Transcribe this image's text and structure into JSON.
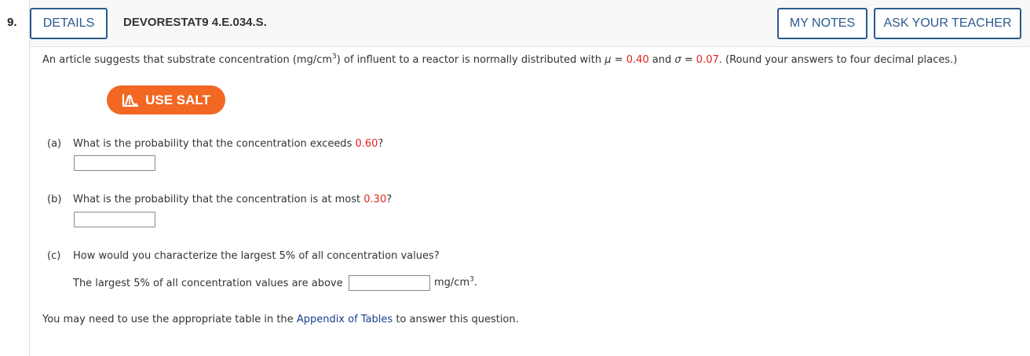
{
  "question_number": "9.",
  "header": {
    "details_label": "DETAILS",
    "question_id": "DEVORESTAT9 4.E.034.S.",
    "my_notes_label": "MY NOTES",
    "ask_teacher_label": "ASK YOUR TEACHER"
  },
  "intro": {
    "text1": "An article suggests that substrate concentration (mg/cm",
    "sup": "3",
    "text2": ") of influent to a reactor is normally distributed with ",
    "mu_symbol": "μ",
    "eq1": " = ",
    "mu_value": "0.40",
    "and": " and ",
    "sigma_symbol": "σ",
    "eq2": " = ",
    "sigma_value": "0.07",
    "text3": ". (Round your answers to four decimal places.)"
  },
  "salt_button": {
    "label": "USE SALT",
    "color": "#f26722"
  },
  "parts": {
    "a": {
      "label": "(a)",
      "question": "What is the probability that the concentration exceeds ",
      "value": "0.60",
      "end": "?",
      "answer": ""
    },
    "b": {
      "label": "(b)",
      "question": "What is the probability that the concentration is at most ",
      "value": "0.30",
      "end": "?",
      "answer": ""
    },
    "c": {
      "label": "(c)",
      "question": "How would you characterize the largest 5% of all concentration values?",
      "statement": "The largest 5% of all concentration values are above",
      "answer": "",
      "unit": "mg/cm",
      "unit_sup": "3",
      "unit_end": "."
    }
  },
  "footer": {
    "text1": "You may need to use the appropriate table in the ",
    "link": "Appendix of Tables",
    "text2": " to answer this question."
  },
  "colors": {
    "accent": "#2a5a8c",
    "highlight": "#e0211b",
    "link": "#1a3f8f"
  }
}
